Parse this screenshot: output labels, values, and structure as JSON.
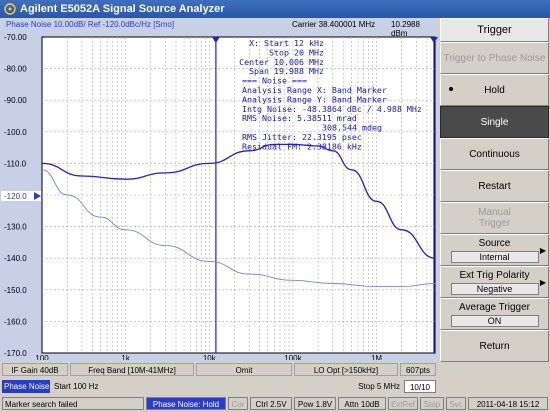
{
  "window": {
    "title": "Agilent E5052A Signal Source Analyzer"
  },
  "plot": {
    "header_left": "Phase Noise 10.00dB/ Ref -120.0dBc/Hz [Smo]",
    "carrier": "Carrier 38.400001 MHz",
    "ref_right": "10.2988 dBm",
    "ref_marker": "-120.0",
    "y_ticks": [
      "-70.00",
      "-80.00",
      "-90.00",
      "-100.0",
      "-110.0",
      "-120.0",
      "-130.0",
      "-140.0",
      "-150.0",
      "-160.0",
      "-170.0"
    ],
    "x_ticks": [
      "100",
      "1k",
      "10k",
      "100k",
      "1M"
    ],
    "annotation": [
      "X: Start 12 kHz",
      "Stop 20 MHz",
      "Center 10.006 MHz",
      "Span 19.988 MHz",
      "=== Noise ===",
      "Analysis Range X: Band Marker",
      "Analysis Range Y: Band Marker",
      "Intg Noise: -48.3864 dBc / 4.988 MHz",
      "RMS Noise: 5.38511 mrad",
      "308.544 mdeg",
      "RMS Jitter: 22.3195 psec",
      "Residual FM: 2.38186 kHz"
    ]
  },
  "chart_data": {
    "type": "line",
    "xlabel": "",
    "ylabel": "",
    "x_scale": "log",
    "xlim": [
      100,
      5000000
    ],
    "ylim": [
      -170,
      -70
    ],
    "grid": true,
    "band_markers_x": [
      12000,
      20000000
    ],
    "series": [
      {
        "name": "",
        "color": "#2020d0",
        "x": [
          100,
          300,
          1000,
          3000,
          10000,
          30000,
          60000,
          100000,
          200000,
          300000,
          500000,
          1000000,
          2000000,
          5000000
        ],
        "y": [
          -110,
          -114,
          -115,
          -113,
          -110,
          -106,
          -104,
          -104,
          -104.5,
          -106,
          -112,
          -122,
          -131,
          -140
        ]
      },
      {
        "name": "",
        "color": "#8080e8",
        "x": [
          100,
          200,
          500,
          1000,
          3000,
          10000,
          30000,
          100000,
          300000,
          1000000,
          2000000,
          5000000
        ],
        "y": [
          -112,
          -120,
          -127,
          -131,
          -136,
          -141,
          -145,
          -147,
          -148,
          -149,
          -149,
          -148
        ]
      }
    ]
  },
  "status1": {
    "if_gain": "IF Gain 40dB",
    "freq_band": "Freq Band [10M-41MHz]",
    "omit": "Omit",
    "lo_opt": "LO Opt [>150kHz]",
    "points": "607pts"
  },
  "status2": {
    "mode": "Phase Noise",
    "start": "Start 100 Hz",
    "stop": "Stop 5 MHz",
    "count": "10/10"
  },
  "status3": {
    "message": "Marker search failed",
    "state": "Phase Noise: Hold",
    "cor": "Cor",
    "ctrl": "Ctrl 2.5V",
    "pow": "Pow 1.8V",
    "attn": "Attn 10dB",
    "extref": "ExtRef",
    "stop": "Stop",
    "svc": "Svc",
    "datetime": "2011-04-18 15:12"
  },
  "softkeys": {
    "title": "Trigger",
    "trigger_to": "Trigger to Phase Noise",
    "hold": "Hold",
    "single": "Single",
    "continuous": "Continuous",
    "restart": "Restart",
    "manual": "Manual Trigger",
    "source": "Source",
    "source_val": "Internal",
    "ext_pol": "Ext Trig Polarity",
    "ext_pol_val": "Negative",
    "avg": "Average Trigger",
    "avg_val": "ON",
    "return": "Return"
  }
}
